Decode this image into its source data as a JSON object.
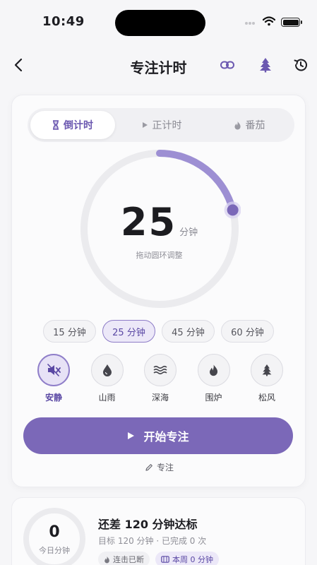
{
  "status": {
    "time": "10:49"
  },
  "nav": {
    "title": "专注计时"
  },
  "modes": [
    {
      "label": "倒计时",
      "icon": "hourglass-icon"
    },
    {
      "label": "正计时",
      "icon": "play-icon"
    },
    {
      "label": "番茄",
      "icon": "flame-icon"
    }
  ],
  "timer": {
    "minutes": "25",
    "unit": "分钟",
    "hint": "拖动圆环调整",
    "progress": 0.21
  },
  "presets": [
    "15 分钟",
    "25 分钟",
    "45 分钟",
    "60 分钟"
  ],
  "sounds": [
    {
      "label": "安静",
      "icon": "mute-speaker-icon"
    },
    {
      "label": "山雨",
      "icon": "raindrop-icon"
    },
    {
      "label": "深海",
      "icon": "waves-icon"
    },
    {
      "label": "围炉",
      "icon": "flame-icon"
    },
    {
      "label": "松风",
      "icon": "pine-tree-icon"
    }
  ],
  "start_button": "开始专注",
  "focus_link": "专注",
  "summary": {
    "today_value": "0",
    "today_label": "今日分钟",
    "goal_title": "还差 120 分钟达标",
    "goal_sub": "目标 120 分钟 · 已完成 0 次",
    "chip_streak": "连击已断",
    "chip_week": "本周 0 分钟"
  },
  "colors": {
    "accent": "#7b68b8",
    "accent_light": "#ece8f8",
    "background": "#f6f6f8"
  }
}
